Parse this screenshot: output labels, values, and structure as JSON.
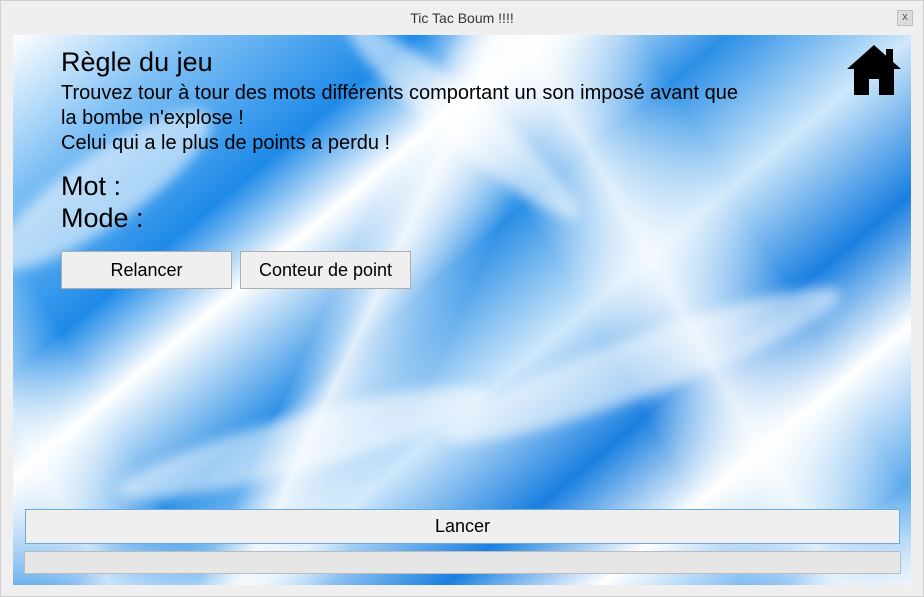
{
  "window": {
    "title": "Tic Tac Boum !!!!",
    "close_label": "x"
  },
  "rules": {
    "title": "Règle du jeu",
    "lines": [
      "Trouvez tour à tour des mots différents comportant un son imposé avant que",
      "la bombe n'explose !",
      "Celui qui a le plus de points a perdu !"
    ]
  },
  "labels": {
    "mot": "Mot :",
    "mode": "Mode :"
  },
  "buttons": {
    "relancer": "Relancer",
    "conteur": "Conteur de point",
    "lancer": "Lancer"
  },
  "progress": {
    "value": 0
  },
  "icons": {
    "home": "home-icon"
  },
  "colors": {
    "accent": "#1e8ae8",
    "progress_fill": "#06b025"
  }
}
